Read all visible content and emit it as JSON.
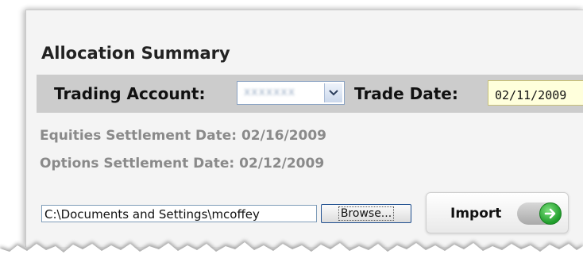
{
  "summary": {
    "title": "Allocation Summary",
    "trading_account_label": "Trading Account:",
    "trading_account_value": "xxxxxxx",
    "trade_date_label": "Trade Date:",
    "trade_date_value": "02/11/2009",
    "equities_settlement": "Equities Settlement Date: 02/16/2009",
    "options_settlement": "Options Settlement Date: 02/12/2009"
  },
  "import": {
    "file_path": "C:\\Documents and Settings\\mcoffey",
    "browse_label": "Browse...",
    "import_label": "Import"
  },
  "colors": {
    "bar_background": "#cccccc",
    "date_field": "#ffffdc",
    "go_green": "#1e9c2a",
    "settlement_text": "#8a8a8a"
  },
  "icons": {
    "dropdown": "chevron-down-icon",
    "go": "arrow-right-icon"
  }
}
